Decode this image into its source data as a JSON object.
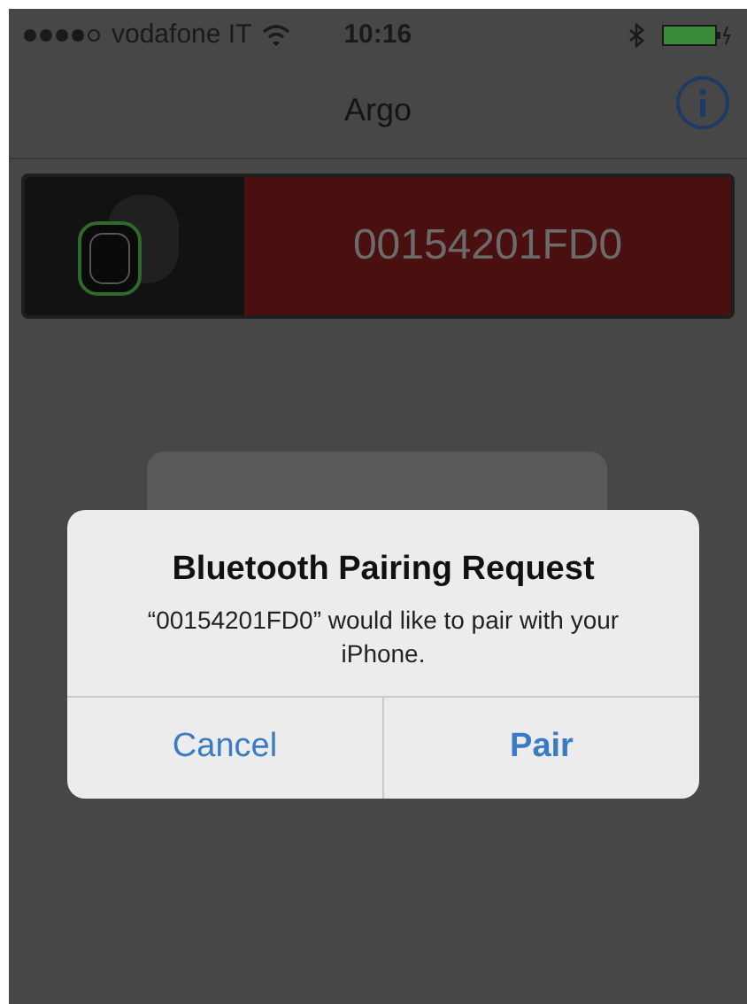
{
  "status_bar": {
    "carrier": "vodafone IT",
    "time": "10:16"
  },
  "nav_bar": {
    "title": "Argo"
  },
  "device_card": {
    "label": "00154201FD0"
  },
  "alert": {
    "title": "Bluetooth Pairing Request",
    "message": "“00154201FD0” would like to pair with your iPhone.",
    "buttons": [
      {
        "label": "Cancel",
        "preferred": false
      },
      {
        "label": "Pair",
        "preferred": true
      }
    ]
  }
}
